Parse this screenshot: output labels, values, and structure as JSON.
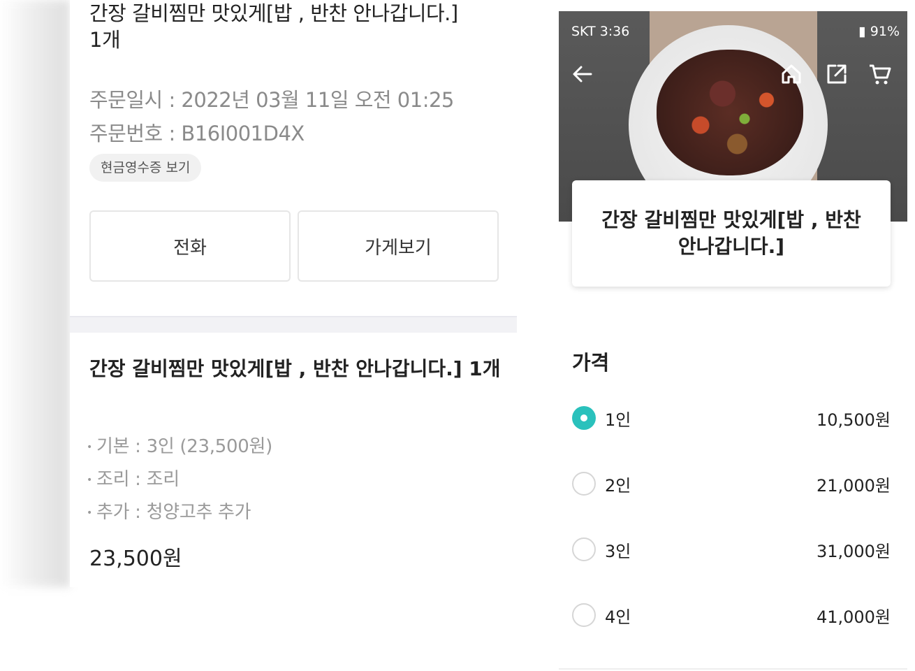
{
  "left_panel": {
    "item_title": "간장 갈비찜만 맛있게[밥 , 반찬 안나갑니다.]",
    "item_qty": "1개",
    "order_datetime": "주문일시 : 2022년 03월 11일 오전 01:25",
    "order_number": "주문번호 : B16I001D4X",
    "receipt_chip": "현금영수증 보기",
    "call_button": "전화",
    "store_button": "가게보기",
    "detail_title": "간장 갈비찜만 맛있게[밥 , 반찬 안나갑니다.] 1개",
    "options": [
      "기본 : 3인 (23,500원)",
      "조리 : 조리",
      "추가 : 청양고추 추가"
    ],
    "total": "23,500원"
  },
  "right_panel": {
    "status": {
      "carrier_time": "SKT 3:36",
      "battery": "91%"
    },
    "product_title": "간장 갈비찜만 맛있게[밥 , 반찬 안나갑니다.]",
    "price_section_title": "가격",
    "price_options": [
      {
        "label": "1인",
        "price": "10,500원",
        "selected": true
      },
      {
        "label": "2인",
        "price": "21,000원",
        "selected": false
      },
      {
        "label": "3인",
        "price": "31,000원",
        "selected": false
      },
      {
        "label": "4인",
        "price": "41,000원",
        "selected": false
      }
    ]
  },
  "icons": {
    "back": "back-arrow-icon",
    "home": "home-icon",
    "share": "share-icon",
    "cart": "cart-icon"
  },
  "colors": {
    "accent": "#2ac1bc"
  }
}
